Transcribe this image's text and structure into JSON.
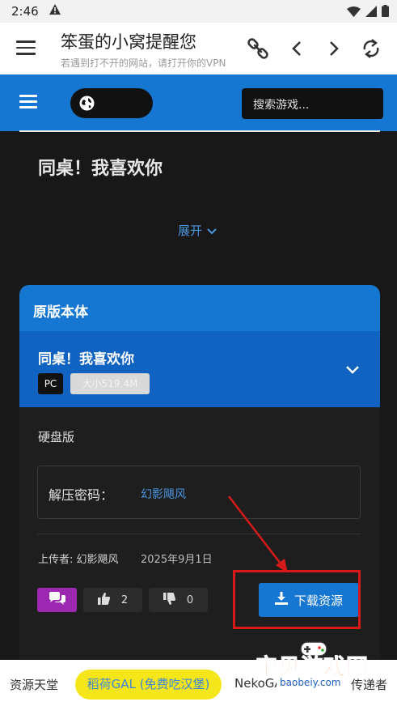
{
  "status_bar": {
    "time": "2:46",
    "icons": [
      "warning-icon",
      "wifi-icon",
      "signal-icon",
      "battery-icon"
    ]
  },
  "app_toolbar": {
    "title": "笨蛋的小窝提醒您",
    "subtitle": "若遇到打不开的网站，请打开你的VPN",
    "icons": [
      "menu-icon",
      "link-icon",
      "back-icon",
      "forward-icon",
      "refresh-icon"
    ]
  },
  "site_header": {
    "search_placeholder": "搜索游戏...",
    "accent_color": "#1677d2"
  },
  "page": {
    "title": "同桌！我喜欢你",
    "expand_label": "展开"
  },
  "resource_card": {
    "header": "原版本体",
    "item_name": "同桌！我喜欢你",
    "platform_badge": "PC",
    "size_badge": "大小519.4M",
    "storage_type": "硬盘版",
    "password_label": "解压密码：",
    "password_value": "幻影飓风",
    "uploader": "上传者: 幻影飓风",
    "upload_date": "2025年9月1日",
    "likes": "2",
    "dislikes": "0",
    "download_label": "下载资源"
  },
  "bottom_bar": {
    "links": [
      "资源天堂",
      "稻荷GAL (免费吃汉堡)",
      "NekoGAL",
      "传递者"
    ]
  },
  "watermark": {
    "main": "宝贝游戏网",
    "sub": "baobeiy.com"
  }
}
